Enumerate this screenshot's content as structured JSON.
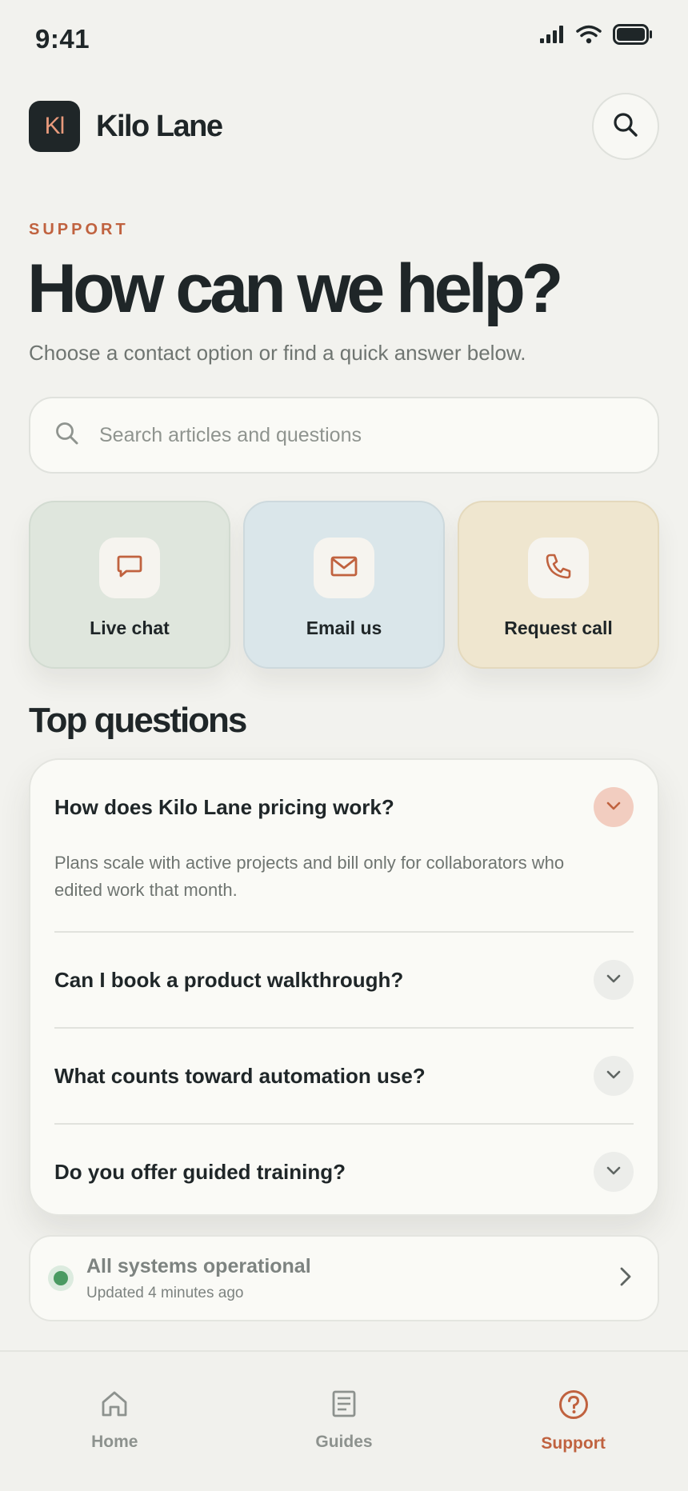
{
  "status_bar": {
    "time": "9:41"
  },
  "header": {
    "logo_text": "Kl",
    "brand_name": "Kilo Lane"
  },
  "hero": {
    "eyebrow": "SUPPORT",
    "title": "How can we help?",
    "subtitle": "Choose a contact option or find a quick answer below."
  },
  "search": {
    "placeholder": "Search articles and questions",
    "value": ""
  },
  "contact_options": [
    {
      "label": "Live chat",
      "icon": "chat-bubble-icon"
    },
    {
      "label": "Email us",
      "icon": "mail-icon"
    },
    {
      "label": "Request call",
      "icon": "phone-icon"
    }
  ],
  "faq": {
    "section_title": "Top questions",
    "items": [
      {
        "question": "How does Kilo Lane pricing work?",
        "answer": "Plans scale with active projects and bill only for collaborators who edited work that month.",
        "expanded": true
      },
      {
        "question": "Can I book a product walkthrough?",
        "expanded": false
      },
      {
        "question": "What counts toward automation use?",
        "expanded": false
      },
      {
        "question": "Do you offer guided training?",
        "expanded": false
      }
    ]
  },
  "system_status": {
    "title": "All systems operational",
    "subtitle": "Updated 4 minutes ago",
    "color": "#4a9a62"
  },
  "tab_bar": {
    "tabs": [
      {
        "label": "Home",
        "icon": "home-icon",
        "active": false
      },
      {
        "label": "Guides",
        "icon": "document-icon",
        "active": false
      },
      {
        "label": "Support",
        "icon": "help-circle-icon",
        "active": true
      }
    ]
  },
  "colors": {
    "accent": "#c0623f",
    "text": "#1f2628",
    "background": "#f2f2ee"
  }
}
